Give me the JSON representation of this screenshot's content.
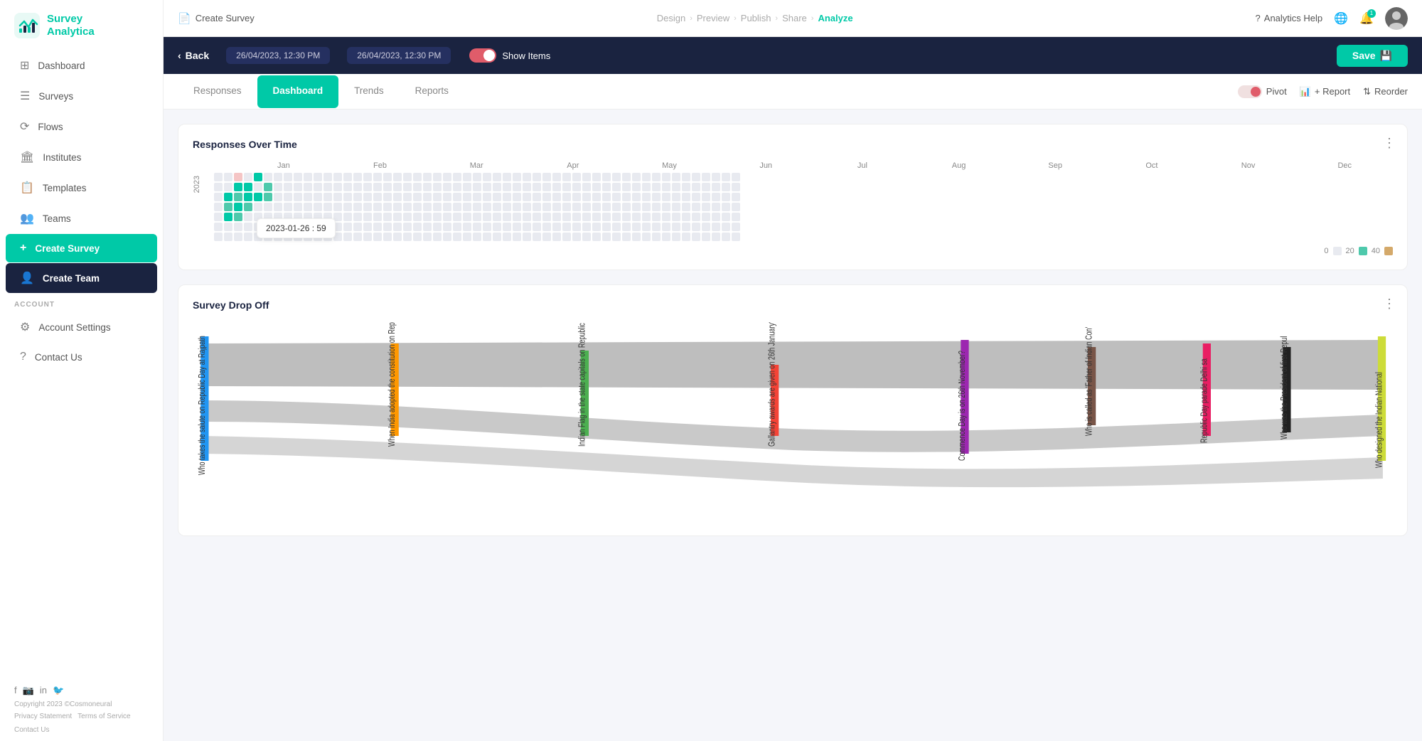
{
  "app": {
    "logo_line1": "Survey",
    "logo_line2": "Analytica"
  },
  "sidebar": {
    "items": [
      {
        "id": "dashboard",
        "label": "Dashboard",
        "icon": "⊞",
        "active": false
      },
      {
        "id": "surveys",
        "label": "Surveys",
        "icon": "☰",
        "active": false
      },
      {
        "id": "flows",
        "label": "Flows",
        "icon": "⟳",
        "active": false
      },
      {
        "id": "institutes",
        "label": "Institutes",
        "icon": "👥",
        "active": false
      },
      {
        "id": "templates",
        "label": "Templates",
        "icon": "📋",
        "active": false
      },
      {
        "id": "teams",
        "label": "Teams",
        "icon": "👥",
        "active": false
      }
    ],
    "create_survey_label": "Create Survey",
    "create_team_label": "Create Team",
    "account_label": "ACCOUNT",
    "account_items": [
      {
        "id": "account-settings",
        "label": "Account Settings",
        "icon": "⚙"
      },
      {
        "id": "contact-us",
        "label": "Contact Us",
        "icon": "?"
      }
    ],
    "copyright": "Copyright 2023 ©Cosmoneural",
    "footer_links": [
      "Privacy Statement",
      "Terms of Service",
      "Contact Us"
    ]
  },
  "topnav": {
    "create_survey": "Create Survey",
    "steps": [
      {
        "id": "design",
        "label": "Design",
        "active": false
      },
      {
        "id": "preview",
        "label": "Preview",
        "active": false
      },
      {
        "id": "publish",
        "label": "Publish",
        "active": false
      },
      {
        "id": "share",
        "label": "Share",
        "active": false
      },
      {
        "id": "analyze",
        "label": "Analyze",
        "active": true
      }
    ],
    "analytics_help": "Analytics Help",
    "bell_count": "1"
  },
  "toolbar": {
    "back_label": "Back",
    "date1": "26/04/2023, 12:30 PM",
    "date2": "26/04/2023, 12:30 PM",
    "show_items_label": "Show Items",
    "save_label": "Save"
  },
  "tabs": {
    "items": [
      {
        "id": "responses",
        "label": "Responses",
        "active": false
      },
      {
        "id": "dashboard",
        "label": "Dashboard",
        "active": true
      },
      {
        "id": "trends",
        "label": "Trends",
        "active": false
      },
      {
        "id": "reports",
        "label": "Reports",
        "active": false
      }
    ],
    "pivot_label": "Pivot",
    "report_label": "+ Report",
    "reorder_label": "Reorder"
  },
  "responses_chart": {
    "title": "Responses Over Time",
    "tooltip_text": "2023-01-26 : 59",
    "months": [
      "Jan",
      "Feb",
      "Mar",
      "Apr",
      "May",
      "Jun",
      "Jul",
      "Aug",
      "Sep",
      "Oct",
      "Nov",
      "Dec"
    ],
    "year_label": "2023",
    "legend": [
      {
        "value": "0",
        "color": "#e8eaf0"
      },
      {
        "value": "20",
        "color": "#4ec9ac"
      },
      {
        "value": "40",
        "color": "#d4a96a"
      }
    ]
  },
  "dropoff_chart": {
    "title": "Survey Drop Off",
    "questions": [
      "Who takes the salute on Republic Day at Rajpath",
      "When India adopted the constitution on Republic Day?",
      "Indian Flag in the state capitals on Republic Day?",
      "Gallantry awards are given on 26th January?",
      "Commence Day is on 26th November?",
      "Who is called as 'Father of Indian Con'",
      "Republic Day parade Delhi sa",
      "Who was the President of first Repul",
      "Who designed the Indian National"
    ]
  },
  "colors": {
    "primary": "#00c9a7",
    "dark": "#1a2340",
    "accent_red": "#e05c6a"
  }
}
